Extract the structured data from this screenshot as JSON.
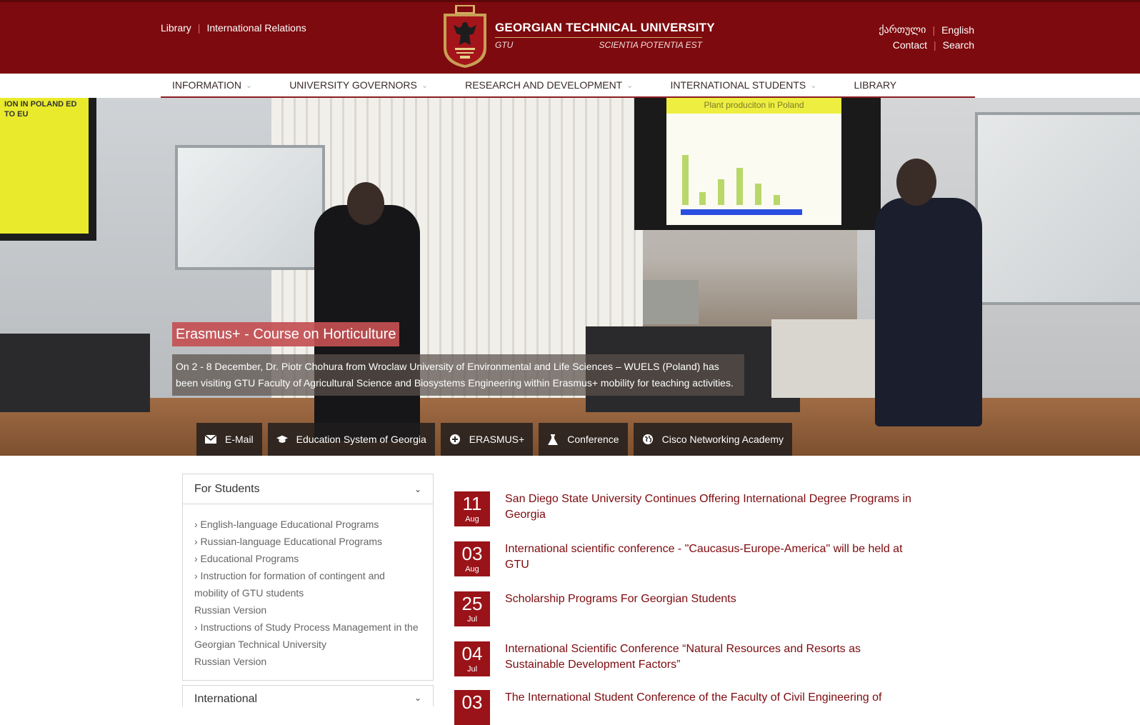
{
  "header": {
    "top_links": [
      "Library",
      "International Relations"
    ],
    "brand_name": "GEORGIAN TECHNICAL UNIVERSITY",
    "brand_short": "GTU",
    "brand_motto": "SCIENTIA POTENTIA EST",
    "languages": [
      "ქართული",
      "English"
    ],
    "utility_links": [
      "Contact",
      "Search"
    ],
    "colors": {
      "primary": "#7d0a0e",
      "accent": "#9a1318"
    }
  },
  "nav": {
    "items": [
      {
        "label": "INFORMATION",
        "has_dropdown": true
      },
      {
        "label": "UNIVERSITY GOVERNORS",
        "has_dropdown": true
      },
      {
        "label": "RESEARCH AND DEVELOPMENT",
        "has_dropdown": true
      },
      {
        "label": "INTERNATIONAL STUDENTS",
        "has_dropdown": true
      },
      {
        "label": "LIBRARY",
        "has_dropdown": false
      }
    ]
  },
  "hero": {
    "title": "Erasmus+ - Course on Horticulture",
    "description": "On 2 - 8 December, Dr. Piotr Chohura from Wroclaw University of Environmental and Life Sciences – WUELS (Poland) has been visiting GTU Faculty of Agricultural Science and Biosystems Engineering within Erasmus+ mobility for teaching activities.",
    "photo_screen_left": "ION IN POLAND ED TO EU",
    "photo_screen_right": "Plant produciton in Poland"
  },
  "quick_links": [
    {
      "label": "E-Mail",
      "icon": "envelope-icon"
    },
    {
      "label": "Education System of Georgia",
      "icon": "graduation-cap-icon"
    },
    {
      "label": "ERASMUS+",
      "icon": "plus-circle-icon"
    },
    {
      "label": "Conference",
      "icon": "flask-icon"
    },
    {
      "label": "Cisco Networking Academy",
      "icon": "globe-icon"
    }
  ],
  "sidebar": {
    "sections": [
      {
        "title": "For Students",
        "items": [
          "› English-language Educational Programs",
          "› Russian-language Educational Programs",
          "› Educational Programs",
          "› Instruction for formation of contingent and mobility of GTU students",
          "Russian Version",
          "› Instructions of Study Process Management in the Georgian Technical University",
          "Russian Version"
        ]
      },
      {
        "title": "International"
      }
    ]
  },
  "news": [
    {
      "day": "11",
      "month": "Aug",
      "title": "San Diego State University Continues Offering International Degree Programs in Georgia"
    },
    {
      "day": "03",
      "month": "Aug",
      "title": "International scientific conference - \"Caucasus-Europe-America\" will be held at GTU"
    },
    {
      "day": "25",
      "month": "Jul",
      "title": "Scholarship Programs For Georgian Students"
    },
    {
      "day": "04",
      "month": "Jul",
      "title": "International Scientific Conference “Natural Resources and Resorts as Sustainable Development Factors”"
    },
    {
      "day": "03",
      "month": "",
      "title": "The International Student Conference of the Faculty of Civil Engineering of"
    }
  ]
}
